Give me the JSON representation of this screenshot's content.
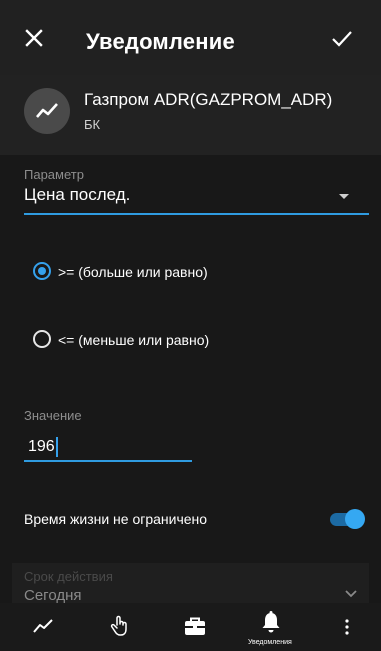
{
  "appbar": {
    "title": "Уведомление",
    "close_icon": "close-icon",
    "confirm_icon": "check-icon"
  },
  "instrument": {
    "icon": "trend-line-icon",
    "name": "Газпром ADR(GAZPROM_ADR)",
    "board": "БК"
  },
  "parameter": {
    "label": "Параметр",
    "value": "Цена послед."
  },
  "conditions": [
    {
      "label": ">= (больше или равно)",
      "selected": true
    },
    {
      "label": "<= (меньше или равно)",
      "selected": false
    }
  ],
  "value_field": {
    "label": "Значение",
    "value": "196"
  },
  "lifetime": {
    "label": "Время жизни не ограничено",
    "enabled": true
  },
  "validity": {
    "label": "Срок действия",
    "value": "Сегодня"
  },
  "bottom_nav": {
    "items": [
      {
        "icon": "chart-line-icon",
        "caption": ""
      },
      {
        "icon": "hand-pointer-icon",
        "caption": ""
      },
      {
        "icon": "briefcase-icon",
        "caption": ""
      },
      {
        "icon": "bell-icon",
        "caption": "Уведомления",
        "active": true
      },
      {
        "icon": "more-vertical-icon",
        "caption": ""
      }
    ]
  },
  "colors": {
    "accent": "#35a1ec",
    "background": "#181818",
    "appbar": "#212121"
  }
}
